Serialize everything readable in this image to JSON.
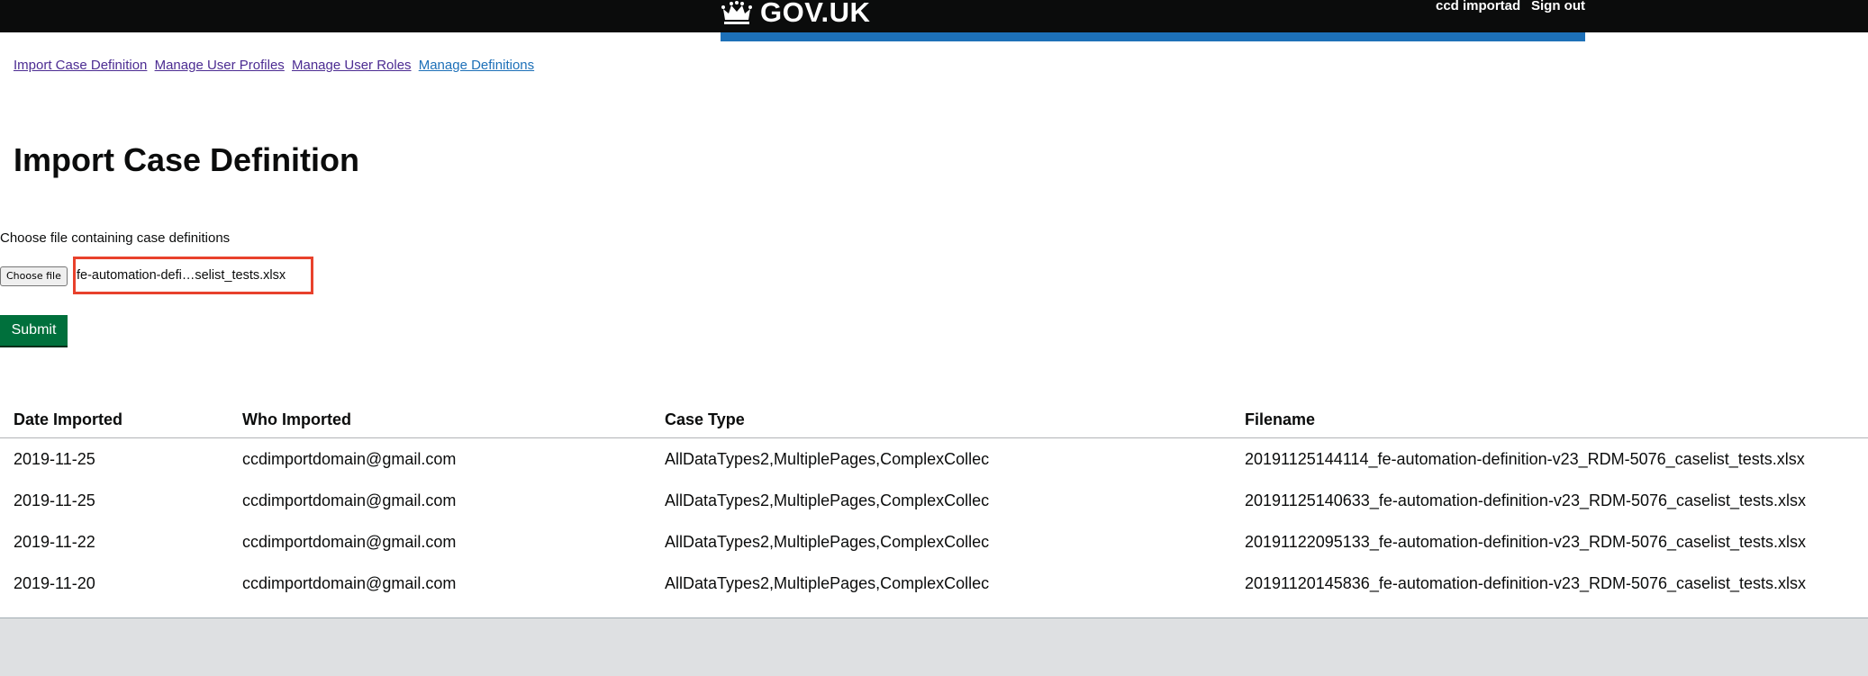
{
  "header": {
    "logo_text": "GOV.UK",
    "user_name": "ccd importad",
    "sign_out_label": "Sign out",
    "accent_color": "#1d70b8"
  },
  "nav": {
    "items": [
      {
        "label": "Import Case Definition"
      },
      {
        "label": "Manage User Profiles"
      },
      {
        "label": "Manage User Roles"
      },
      {
        "label": "Manage Definitions"
      }
    ]
  },
  "main": {
    "title": "Import Case Definition",
    "file_label": "Choose file containing case definitions",
    "choose_file_label": "Choose file",
    "selected_file": "fe-automation-defi…selist_tests.xlsx",
    "submit_label": "Submit",
    "submit_color": "#00703c"
  },
  "table": {
    "headers": [
      "Date Imported",
      "Who Imported",
      "Case Type",
      "Filename"
    ],
    "rows": [
      [
        "2019-11-25",
        "ccdimportdomain@gmail.com",
        "AllDataTypes2,MultiplePages,ComplexCollec",
        "20191125144114_fe-automation-definition-v23_RDM-5076_caselist_tests.xlsx"
      ],
      [
        "2019-11-25",
        "ccdimportdomain@gmail.com",
        "AllDataTypes2,MultiplePages,ComplexCollec",
        "20191125140633_fe-automation-definition-v23_RDM-5076_caselist_tests.xlsx"
      ],
      [
        "2019-11-22",
        "ccdimportdomain@gmail.com",
        "AllDataTypes2,MultiplePages,ComplexCollec",
        "20191122095133_fe-automation-definition-v23_RDM-5076_caselist_tests.xlsx"
      ],
      [
        "2019-11-20",
        "ccdimportdomain@gmail.com",
        "AllDataTypes2,MultiplePages,ComplexCollec",
        "20191120145836_fe-automation-definition-v23_RDM-5076_caselist_tests.xlsx"
      ]
    ]
  }
}
